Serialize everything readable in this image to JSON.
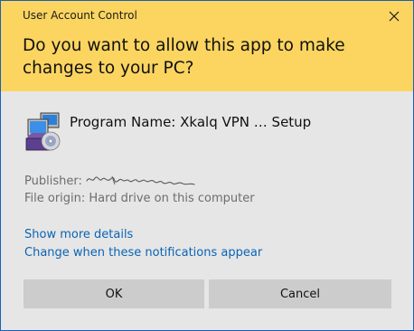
{
  "window": {
    "title": "User Account Control",
    "question": "Do you want to allow this app to make changes to your PC?",
    "close_icon": "close-icon"
  },
  "program": {
    "name_line": "Program Name: Xkalq VPN … Setup",
    "icon": "installer-package-icon"
  },
  "details": {
    "publisher_label": "Publisher:",
    "publisher_value_hint": "signature",
    "file_origin": "File origin: Hard drive on this computer"
  },
  "links": {
    "show_more": "Show more details",
    "change_notifications": "Change when these notifications appear"
  },
  "buttons": {
    "ok": "OK",
    "cancel": "Cancel"
  },
  "colors": {
    "header_bg": "#fbd560",
    "body_bg": "#e6e6e6",
    "link": "#0a64b4",
    "button_bg": "#cccccc",
    "border": "#1a5fb4"
  }
}
